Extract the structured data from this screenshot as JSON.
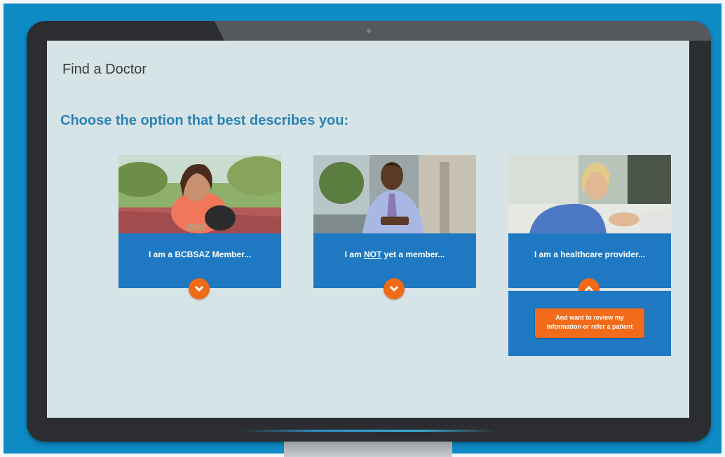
{
  "page": {
    "title": "Find a Doctor",
    "prompt": "Choose the option that best describes you:"
  },
  "options": [
    {
      "label_pre": "I am a BCBSAZ Member...",
      "photo": "woman-runner-photo",
      "chevron": "chevron-down-icon"
    },
    {
      "label_pre": "I am ",
      "label_emph": "NOT",
      "label_post": " yet a member...",
      "photo": "businessman-photo",
      "chevron": "chevron-down-icon"
    },
    {
      "label_pre": "I am a healthcare provider...",
      "photo": "nurse-photo",
      "chevron": "chevron-up-icon",
      "sub_action": "And want to review my information or refer a patient"
    }
  ],
  "colors": {
    "accent": "#1f79c2",
    "button": "#f06a17",
    "title": "#2a82b4",
    "screen": "#d7e4e7",
    "background": "#0e8ac4"
  }
}
